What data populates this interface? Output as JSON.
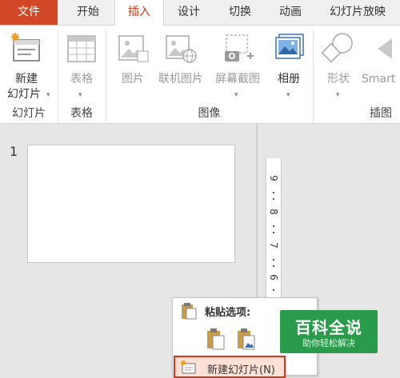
{
  "tabs": [
    {
      "label": "文件"
    },
    {
      "label": "开始"
    },
    {
      "label": "插入"
    },
    {
      "label": "设计"
    },
    {
      "label": "切换"
    },
    {
      "label": "动画"
    },
    {
      "label": "幻灯片放映"
    }
  ],
  "active_tab": "插入",
  "ribbon": {
    "new_slide": {
      "line1": "新建",
      "line2": "幻灯片",
      "arrow": "▾"
    },
    "table": {
      "label": "表格",
      "arrow": "▾"
    },
    "picture": {
      "label": "图片"
    },
    "online_picture": {
      "label": "联机图片"
    },
    "screenshot": {
      "label": "屏幕截图",
      "arrow": "▾"
    },
    "album": {
      "label": "相册",
      "arrow": "▾"
    },
    "shapes": {
      "label": "形状",
      "arrow": "▾"
    },
    "smartart": {
      "label": "Smart"
    },
    "groups": {
      "slides": "幻灯片",
      "tables": "表格",
      "images": "图像",
      "illustrations": "插图"
    }
  },
  "slide_panel": {
    "slide_number": "1"
  },
  "ruler": {
    "numbers": [
      "9",
      "8",
      "7",
      "6"
    ]
  },
  "context_menu": {
    "paste_title": "粘贴选项:",
    "new_slide_label": "新建幻灯片(N)"
  },
  "watermark": {
    "title": "百科全说",
    "subtitle": "助你轻松解决"
  },
  "colors": {
    "file_tab": "#d24726",
    "active_tab_text": "#c43e1c",
    "highlight_border": "#d9321f",
    "highlight_fill": "#fde1d7",
    "watermark_green": "#2a9a4b"
  }
}
